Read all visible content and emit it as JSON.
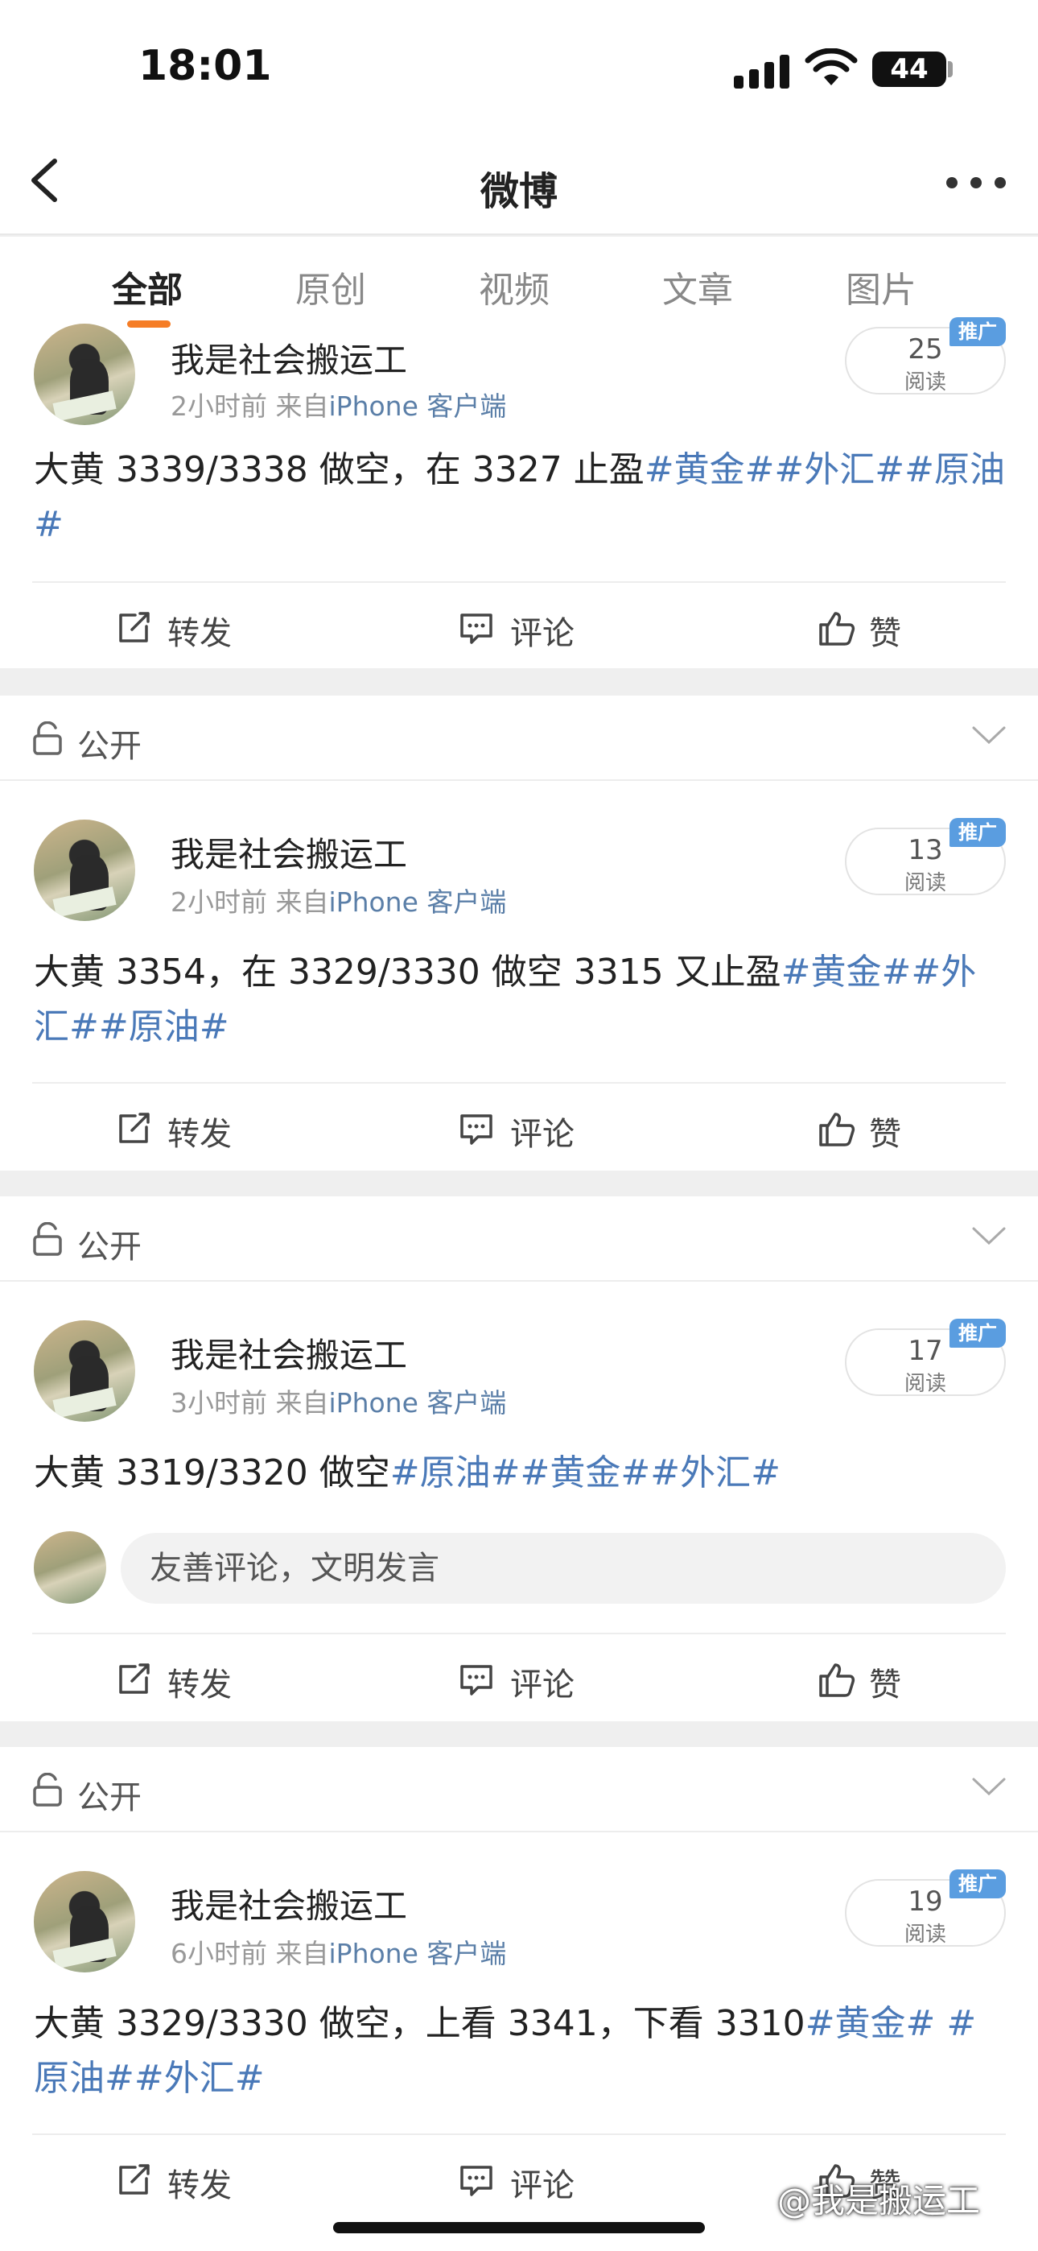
{
  "status": {
    "time": "18:01",
    "battery": "44"
  },
  "nav": {
    "title": "微博"
  },
  "tabs": [
    "全部",
    "原创",
    "视频",
    "文章",
    "图片"
  ],
  "visibility_label": "公开",
  "read_label": "阅读",
  "promo_label": "推广",
  "actions": {
    "repost": "转发",
    "comment": "评论",
    "like": "赞"
  },
  "comment_placeholder": "友善评论，文明发言",
  "posts": [
    {
      "username": "我是社会搬运工",
      "time": "2小时前",
      "from": "来自",
      "source": "iPhone 客户端",
      "reads": "25",
      "text": "大黄 3339/3338 做空，在 3327 止盈",
      "tags": "#黄金##外汇##原油#"
    },
    {
      "username": "我是社会搬运工",
      "time": "2小时前",
      "from": "来自",
      "source": "iPhone 客户端",
      "reads": "13",
      "text": "大黄 3354，在 3329/3330 做空 3315 又止盈",
      "tags": "#黄金##外汇##原油#"
    },
    {
      "username": "我是社会搬运工",
      "time": "3小时前",
      "from": "来自",
      "source": "iPhone 客户端",
      "reads": "17",
      "text": "大黄 3319/3320 做空",
      "tags": "#原油##黄金##外汇#"
    },
    {
      "username": "我是社会搬运工",
      "time": "6小时前",
      "from": "来自",
      "source": "iPhone 客户端",
      "reads": "19",
      "text": "大黄 3329/3330 做空，上看 3341，下看 3310",
      "tags": "#黄金# #原油##外汇#"
    }
  ],
  "watermark": "@我是搬运工"
}
